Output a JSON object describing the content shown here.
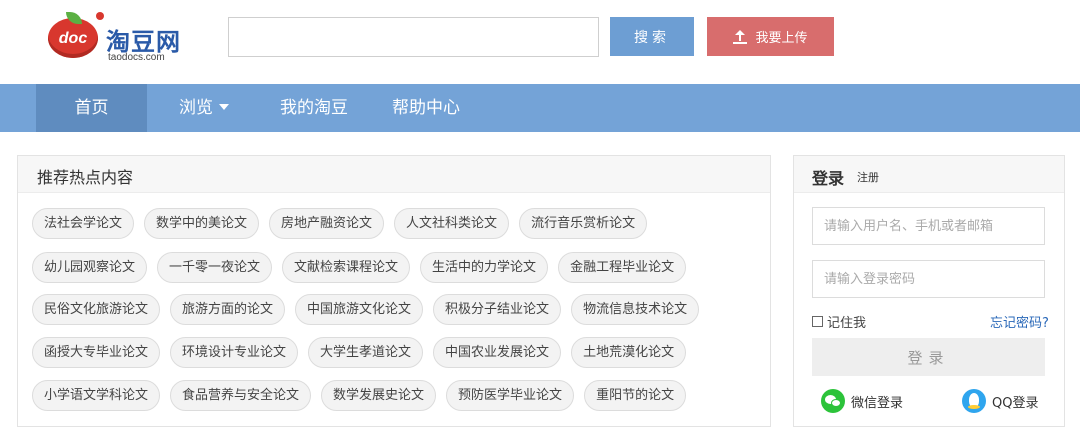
{
  "logo": {
    "badge_text": "doc",
    "name": "淘豆网",
    "domain": "taodocs.com"
  },
  "search": {
    "placeholder": "",
    "button_label": "搜索"
  },
  "upload": {
    "button_label": "我要上传",
    "icon": "upload-icon"
  },
  "nav": {
    "items": [
      {
        "label": "首页",
        "active": true
      },
      {
        "label": "浏览",
        "has_dropdown": true
      },
      {
        "label": "我的淘豆"
      },
      {
        "label": "帮助中心"
      }
    ]
  },
  "hot": {
    "title": "推荐热点内容",
    "rows": [
      [
        "法社会学论文",
        "数学中的美论文",
        "房地产融资论文",
        "人文社科类论文",
        "流行音乐赏析论文"
      ],
      [
        "幼儿园观察论文",
        "一千零一夜论文",
        "文献检索课程论文",
        "生活中的力学论文",
        "金融工程毕业论文"
      ],
      [
        "民俗文化旅游论文",
        "旅游方面的论文",
        "中国旅游文化论文",
        "积极分子结业论文",
        "物流信息技术论文"
      ],
      [
        "函授大专毕业论文",
        "环境设计专业论文",
        "大学生孝道论文",
        "中国农业发展论文",
        "土地荒漠化论文"
      ],
      [
        "小学语文学科论文",
        "食品营养与安全论文",
        "数学发展史论文",
        "预防医学毕业论文",
        "重阳节的论文"
      ]
    ]
  },
  "login": {
    "title": "登录",
    "register_label": "注册",
    "username_placeholder": "请输入用户名、手机或者邮箱",
    "password_placeholder": "请输入登录密码",
    "remember_label": "记住我",
    "forgot_label": "忘记密码?",
    "submit_label": "登录",
    "wechat_label": "微信登录",
    "qq_label": "QQ登录"
  },
  "colors": {
    "nav_bg": "#74a3d7",
    "nav_active": "#5f8cbf",
    "search_btn": "#6d9ed3",
    "upload_btn": "#d86d6d",
    "link": "#2a68b8"
  }
}
